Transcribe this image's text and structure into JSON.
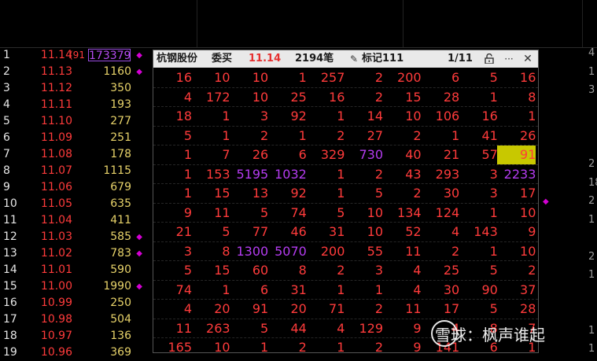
{
  "order_book": [
    {
      "idx": "1",
      "price": "11.14",
      "paren": "(91",
      "qty": "173379",
      "boxed": true,
      "dot": true
    },
    {
      "idx": "2",
      "price": "11.13",
      "qty": "1160",
      "dot": true
    },
    {
      "idx": "3",
      "price": "11.12",
      "qty": "350",
      "dot": false
    },
    {
      "idx": "4",
      "price": "11.11",
      "qty": "193",
      "dot": false
    },
    {
      "idx": "5",
      "price": "11.10",
      "qty": "277",
      "dot": false
    },
    {
      "idx": "6",
      "price": "11.09",
      "qty": "251",
      "dot": false
    },
    {
      "idx": "7",
      "price": "11.08",
      "qty": "178",
      "dot": false
    },
    {
      "idx": "8",
      "price": "11.07",
      "qty": "1115",
      "dot": false
    },
    {
      "idx": "9",
      "price": "11.06",
      "qty": "679",
      "dot": false
    },
    {
      "idx": "10",
      "price": "11.05",
      "qty": "635",
      "dot": false
    },
    {
      "idx": "11",
      "price": "11.04",
      "qty": "411",
      "dot": false
    },
    {
      "idx": "12",
      "price": "11.03",
      "qty": "585",
      "dot": true
    },
    {
      "idx": "13",
      "price": "11.02",
      "qty": "783",
      "dot": true
    },
    {
      "idx": "14",
      "price": "11.01",
      "qty": "590",
      "dot": false
    },
    {
      "idx": "15",
      "price": "11.00",
      "qty": "1990",
      "dot": true
    },
    {
      "idx": "16",
      "price": "10.99",
      "qty": "250",
      "dot": false
    },
    {
      "idx": "17",
      "price": "10.98",
      "qty": "504",
      "dot": false
    },
    {
      "idx": "18",
      "price": "10.97",
      "qty": "136",
      "dot": false
    },
    {
      "idx": "19",
      "price": "10.96",
      "qty": "369",
      "dot": false
    }
  ],
  "right_edge": [
    "4",
    "1",
    "3",
    "",
    "",
    "",
    "2",
    "18",
    "2",
    "1",
    "",
    "2",
    "1",
    "",
    "",
    "1",
    "1"
  ],
  "panel": {
    "stock_name": "杭钢股份",
    "order_type": "委买",
    "price": "11.14",
    "count": "2194笔",
    "mark_label": "标记111",
    "page": "1/11",
    "icons": [
      "unlock-icon",
      "more-icon",
      "close-icon"
    ]
  },
  "panel_rows": [
    [
      "16",
      "10",
      "10",
      "1",
      "257",
      "2",
      "200",
      "6",
      "5",
      "16"
    ],
    [
      "4",
      "172",
      "10",
      "25",
      "16",
      "2",
      "15",
      "28",
      "1",
      "8"
    ],
    [
      "18",
      "1",
      "3",
      "92",
      "1",
      "14",
      "10",
      "106",
      "16",
      "1"
    ],
    [
      "5",
      "1",
      "2",
      "1",
      "2",
      "27",
      "2",
      "1",
      "41",
      "26"
    ],
    [
      "1",
      "7",
      "26",
      "6",
      "329",
      "730",
      "40",
      "21",
      "57",
      "91"
    ],
    [
      "1",
      "153",
      "5195",
      "1032",
      "1",
      "2",
      "43",
      "293",
      "3",
      "2233"
    ],
    [
      "1",
      "15",
      "13",
      "92",
      "1",
      "5",
      "2",
      "30",
      "3",
      "17"
    ],
    [
      "9",
      "11",
      "5",
      "74",
      "5",
      "10",
      "134",
      "124",
      "1",
      "10"
    ],
    [
      "21",
      "5",
      "77",
      "46",
      "31",
      "10",
      "52",
      "4",
      "143",
      "9"
    ],
    [
      "3",
      "8",
      "1300",
      "5070",
      "200",
      "55",
      "11",
      "2",
      "1",
      "10"
    ],
    [
      "5",
      "15",
      "60",
      "8",
      "2",
      "3",
      "4",
      "25",
      "5",
      "2"
    ],
    [
      "74",
      "1",
      "6",
      "31",
      "1",
      "1",
      "4",
      "30",
      "90",
      "37"
    ],
    [
      "4",
      "20",
      "91",
      "20",
      "71",
      "2",
      "11",
      "17",
      "5",
      "28"
    ],
    [
      "11",
      "263",
      "5",
      "44",
      "4",
      "129",
      "9",
      "4",
      "8",
      "7"
    ],
    [
      "165",
      "10",
      "1",
      "2",
      "1",
      "2",
      "9",
      "141",
      "6",
      "1"
    ]
  ],
  "purple_cells": [
    "4-5",
    "5-2",
    "5-3",
    "5-9",
    "9-2",
    "9-3"
  ],
  "highlight_cells": [
    "4-9"
  ],
  "watermark": "雪球：枫声谁起",
  "colors": {
    "red": "#ff3b3b",
    "yellow": "#e8d36a",
    "purple": "#b43cf0",
    "highlight": "#c8c800",
    "dot": "#d400d4"
  }
}
